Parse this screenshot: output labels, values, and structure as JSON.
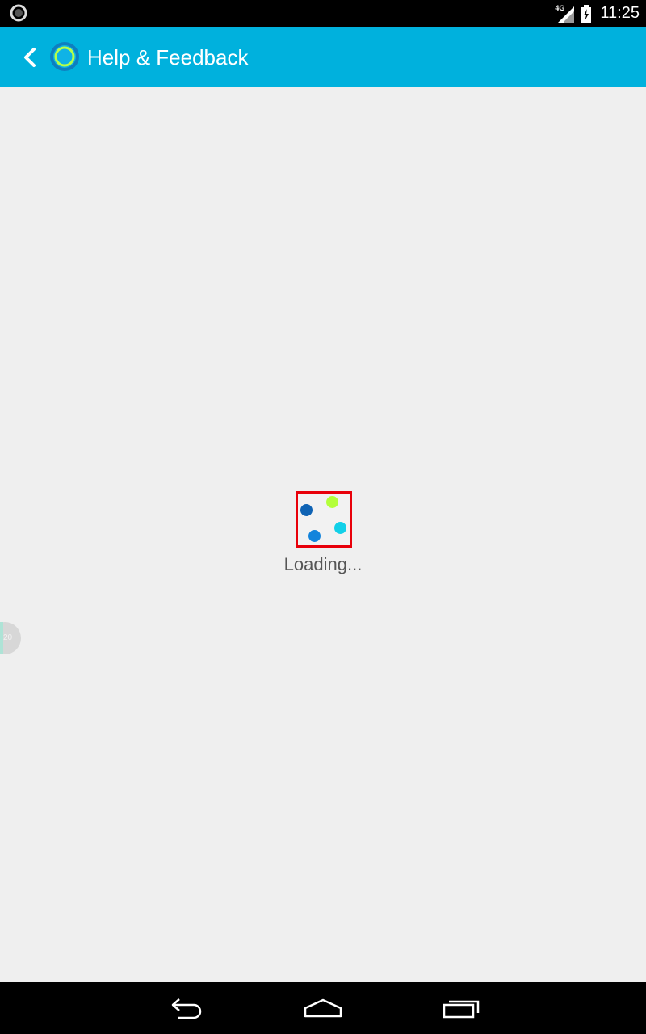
{
  "status_bar": {
    "network_type": "4G",
    "time": "11:25",
    "icons": [
      "circle-status-icon",
      "signal-icon",
      "battery-icon"
    ]
  },
  "app_bar": {
    "title": "Help & Feedback",
    "background_color": "#00b1dd",
    "icons": [
      "back-arrow-icon",
      "app-logo-icon"
    ]
  },
  "content": {
    "loading_text": "Loading...",
    "spinner_dot_colors": [
      "#0f63b4",
      "#b3ff3a",
      "#12d0e8",
      "#1284dc"
    ],
    "spinner_frame_color": "#e8000a",
    "side_handle_label": "20"
  },
  "nav_bar": {
    "icons": [
      "back-icon",
      "home-icon",
      "recent-apps-icon"
    ]
  }
}
